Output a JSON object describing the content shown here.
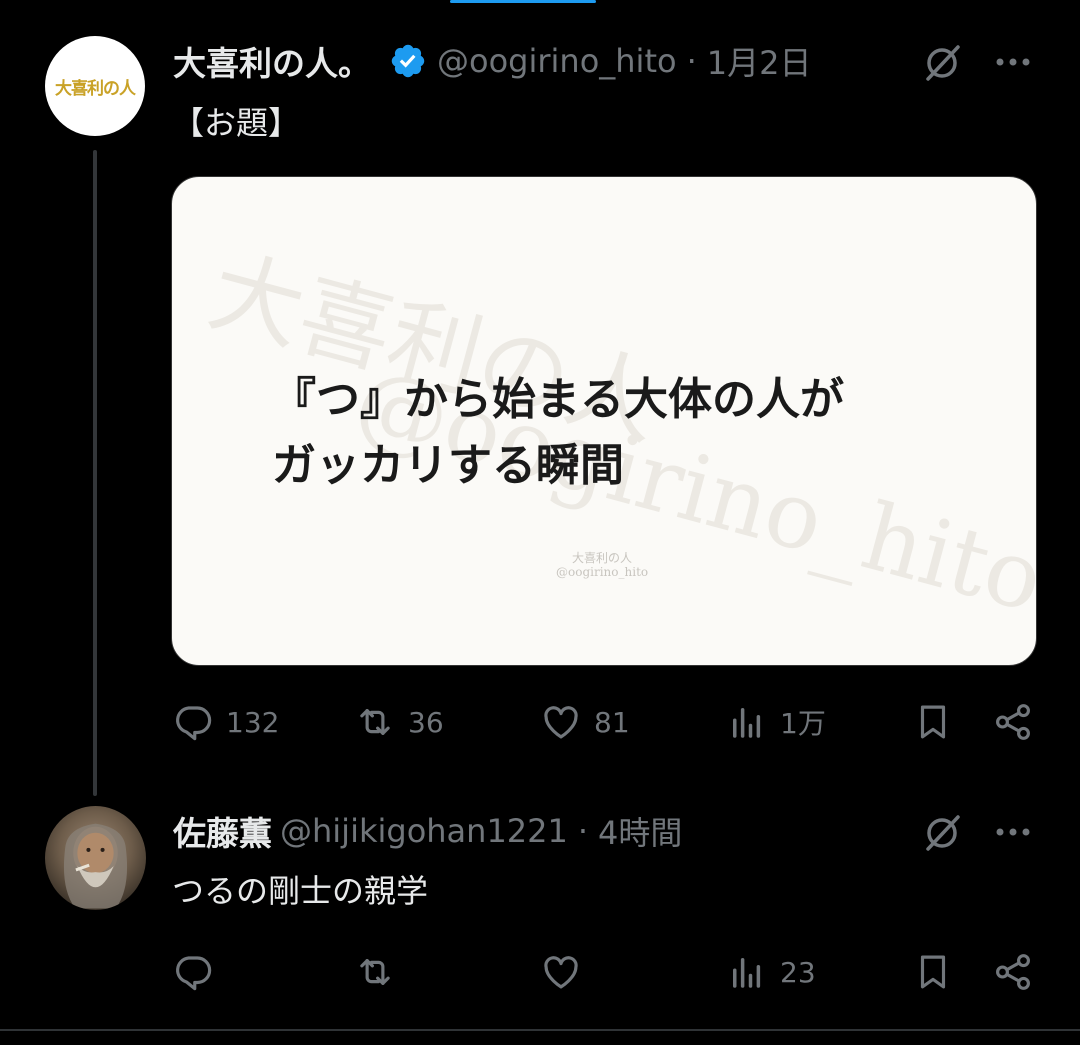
{
  "tweet": {
    "author_name": "大喜利の人。",
    "handle": "@oogirino_hito",
    "separator": "·",
    "time": "1月2日",
    "avatar_text": "大喜利の人",
    "text": "【お題】",
    "media": {
      "caption": "『つ』から始まる大体の人が\nガッカリする瞬間",
      "watermark_big": "大喜利の人",
      "watermark_big2": "@oogirino_hito",
      "watermark_small_1": "大喜利の人",
      "watermark_small_2": "@oogirino_hito"
    },
    "replies": "132",
    "retweets": "36",
    "likes": "81",
    "views": "1万"
  },
  "reply": {
    "author_name": "佐藤薫",
    "handle": "@hijikigohan1221",
    "separator": "·",
    "time": "4時間",
    "text": "つるの剛士の親学",
    "views": "23"
  },
  "colors": {
    "background": "#000000",
    "text": "#e7e9ea",
    "secondary": "#71767b",
    "verified": "#1d9bf0"
  }
}
